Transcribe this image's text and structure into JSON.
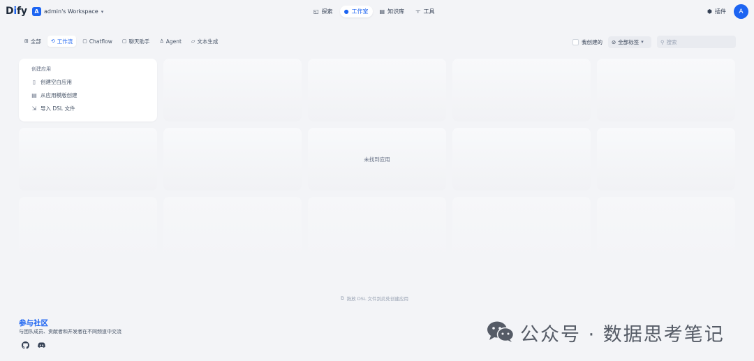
{
  "header": {
    "logo_prefix": "D",
    "logo_accent": "i",
    "logo_suffix": "fy",
    "workspace_initial": "A",
    "workspace_name": "admin's Workspace",
    "nav": [
      {
        "label": "探索",
        "icon": "explore-icon"
      },
      {
        "label": "工作室",
        "icon": "studio-icon"
      },
      {
        "label": "知识库",
        "icon": "knowledge-icon"
      },
      {
        "label": "工具",
        "icon": "tools-icon"
      }
    ],
    "active_nav": "工作室",
    "plugins_label": "插件",
    "user_initial": "A"
  },
  "filters": [
    {
      "label": "全部",
      "icon": "grid-icon"
    },
    {
      "label": "工作流",
      "icon": "workflow-icon"
    },
    {
      "label": "Chatflow",
      "icon": "chatflow-icon"
    },
    {
      "label": "聊天助手",
      "icon": "chat-icon"
    },
    {
      "label": "Agent",
      "icon": "agent-icon"
    },
    {
      "label": "文本生成",
      "icon": "text-gen-icon"
    }
  ],
  "active_filter": "工作流",
  "toolbar": {
    "my_created_label": "我创建的",
    "tags_label": "全部标签",
    "search_placeholder": "搜索"
  },
  "create_card": {
    "title": "创建应用",
    "items": [
      {
        "label": "创建空白应用",
        "icon": "blank-file-icon"
      },
      {
        "label": "从应用模版创建",
        "icon": "template-icon"
      },
      {
        "label": "导入 DSL 文件",
        "icon": "import-icon"
      }
    ]
  },
  "empty_text": "未找到应用",
  "drag_hint": "拖放 DSL 文件到此处创建应用",
  "community": {
    "title": "参与社区",
    "description": "与团队成员、贡献者和开发者在不同频道中交流",
    "links": [
      "github-icon",
      "discord-icon"
    ]
  },
  "watermark": "公众号 · 数据思考笔记",
  "colors": {
    "accent": "#1c64f2",
    "background": "#f3f4f7"
  }
}
